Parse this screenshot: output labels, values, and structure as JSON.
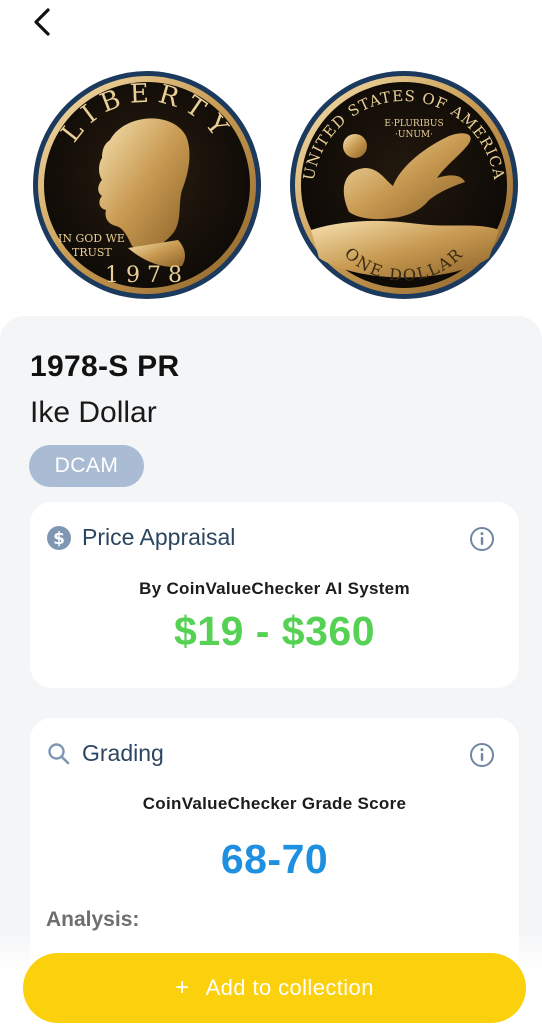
{
  "nav": {
    "back_icon": "chevron-left-icon"
  },
  "coins": {
    "obverse": {
      "legend_top": "LIBERTY",
      "motto": [
        "IN GOD WE",
        "TRUST"
      ],
      "year": "1978"
    },
    "reverse": {
      "legend_top": "UNITED STATES OF AMERICA",
      "motto": [
        "E·PLURIBUS",
        "·UNUM·"
      ],
      "denomination": "ONE DOLLAR"
    }
  },
  "coin": {
    "title": "1978-S PR",
    "name": "Ike Dollar",
    "badge": "DCAM"
  },
  "price_card": {
    "icon": "dollar-circle-icon",
    "title": "Price Appraisal",
    "caption": "By CoinValueChecker AI System",
    "range": "$19 - $360"
  },
  "grading_card": {
    "icon": "search-icon",
    "title": "Grading",
    "caption": "CoinValueChecker Grade Score",
    "range": "68-70",
    "analysis_label": "Analysis:"
  },
  "cta": {
    "plus": "+",
    "label": "Add to collection"
  },
  "colors": {
    "price": "#55d154",
    "grade": "#1f8fe0",
    "badge": "#a9bcd3",
    "cta": "#fbd00c",
    "card_title": "#2c4660"
  }
}
